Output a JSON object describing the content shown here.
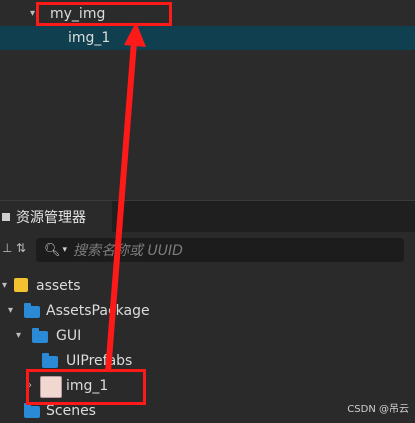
{
  "hierarchy": {
    "root_label": "my_img",
    "child_label": "img_1"
  },
  "assets_panel": {
    "tab_title": "资源管理器",
    "search_placeholder": "搜索名称或 UUID"
  },
  "tree": {
    "assets": "assets",
    "assets_package": "AssetsPackage",
    "gui": "GUI",
    "ui_prefabs": "UIPrefabs",
    "img_1": "img_1",
    "scenes": "Scenes"
  },
  "colors": {
    "annotation": "#ff1a1a",
    "selection": "#10404f",
    "folder": "#2a8ad6"
  },
  "watermark": "CSDN @吊云"
}
